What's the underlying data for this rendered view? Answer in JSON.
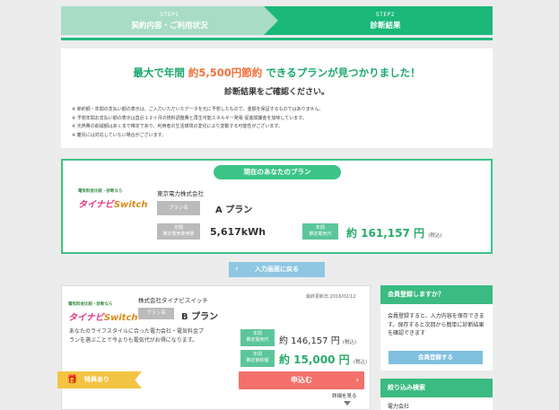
{
  "steps": [
    {
      "label": "STEP1",
      "title": "契約内容・ご利用状況"
    },
    {
      "label": "STEP2",
      "title": "診断結果"
    }
  ],
  "summary": {
    "headline_pre": "最大で年間",
    "headline_amount": "約5,500円節約",
    "headline_post": "できるプランが見つかりました！",
    "subhead": "診断結果をご確認ください。",
    "notes": [
      "※ 節約額・年間の支払い額の表示は、ご入力いただいたデータを元に予想したもので、金額を保証するものではありません。",
      "※ 予想年間お支払い額の表示は直近１２ヶ月の燃料調整費と再生可能エネルギー発電 促進賦課金を加味しています。",
      "※ 光熱費の削減額はあくまで推定であり、利用者の生活環境の変化により変動する可能性がございます。",
      "※ 離島には対応していない場合がございます。"
    ]
  },
  "current_plan": {
    "badge": "現在のあなたのプラン",
    "logo_small": "電気料金比較・診断なら",
    "logo_brand": "タイナビ",
    "logo_switch": "Switch",
    "company": "東京電力株式会社",
    "plan_tag": "プラン名",
    "plan_name": "A プラン",
    "usage_tag_line1": "年間",
    "usage_tag_line2": "推定電気使用量",
    "usage_value": "5,617kWh",
    "cost_tag_line1": "年間",
    "cost_tag_line2": "推定電気代",
    "cost_value": "約 161,157 円",
    "cost_suffix": "(税込)"
  },
  "back_button": {
    "icon": "chevron-left-icon",
    "label": "入力画面に戻る"
  },
  "result_card": {
    "logo_small": "電気料金比較・診断なら",
    "logo_brand": "タイナビ",
    "logo_switch": "Switch",
    "company": "株式会社タイナビスイッチ",
    "date": "最終更新日:2016/02/12",
    "plan_tag": "プラン名",
    "plan_name": "B プラン",
    "description": "あなたのライフスタイルに合った電力会社・電気料金プランを選ぶことで今よりも電気代がお得になります。",
    "cost_tag_line1": "年間",
    "cost_tag_line2": "推定電気代",
    "cost_value": "約 146,157 円",
    "cost_suffix": "(税込)",
    "save_tag_line1": "年間",
    "save_tag_line2": "推定節約額",
    "save_value": "約 15,000 円",
    "save_suffix": "(税込)",
    "benefit_label": "特典あり",
    "benefit_icon": "gift-icon",
    "apply_label": "申込む",
    "details_label": "詳細を見る"
  },
  "sidebar": {
    "register_title": "会員登録しますか？",
    "register_text": "会員登録すると、入力内容を保存できます。保存すると次回から簡単に診断結果を確認できます",
    "register_button": "会員登録する",
    "filter_title": "絞り込み検索",
    "filter_item": "電力会社"
  },
  "colors": {
    "accent": "#1ab97a",
    "highlight": "#ef6f3a",
    "apply": "#f4716b",
    "benefit": "#f3c443"
  }
}
